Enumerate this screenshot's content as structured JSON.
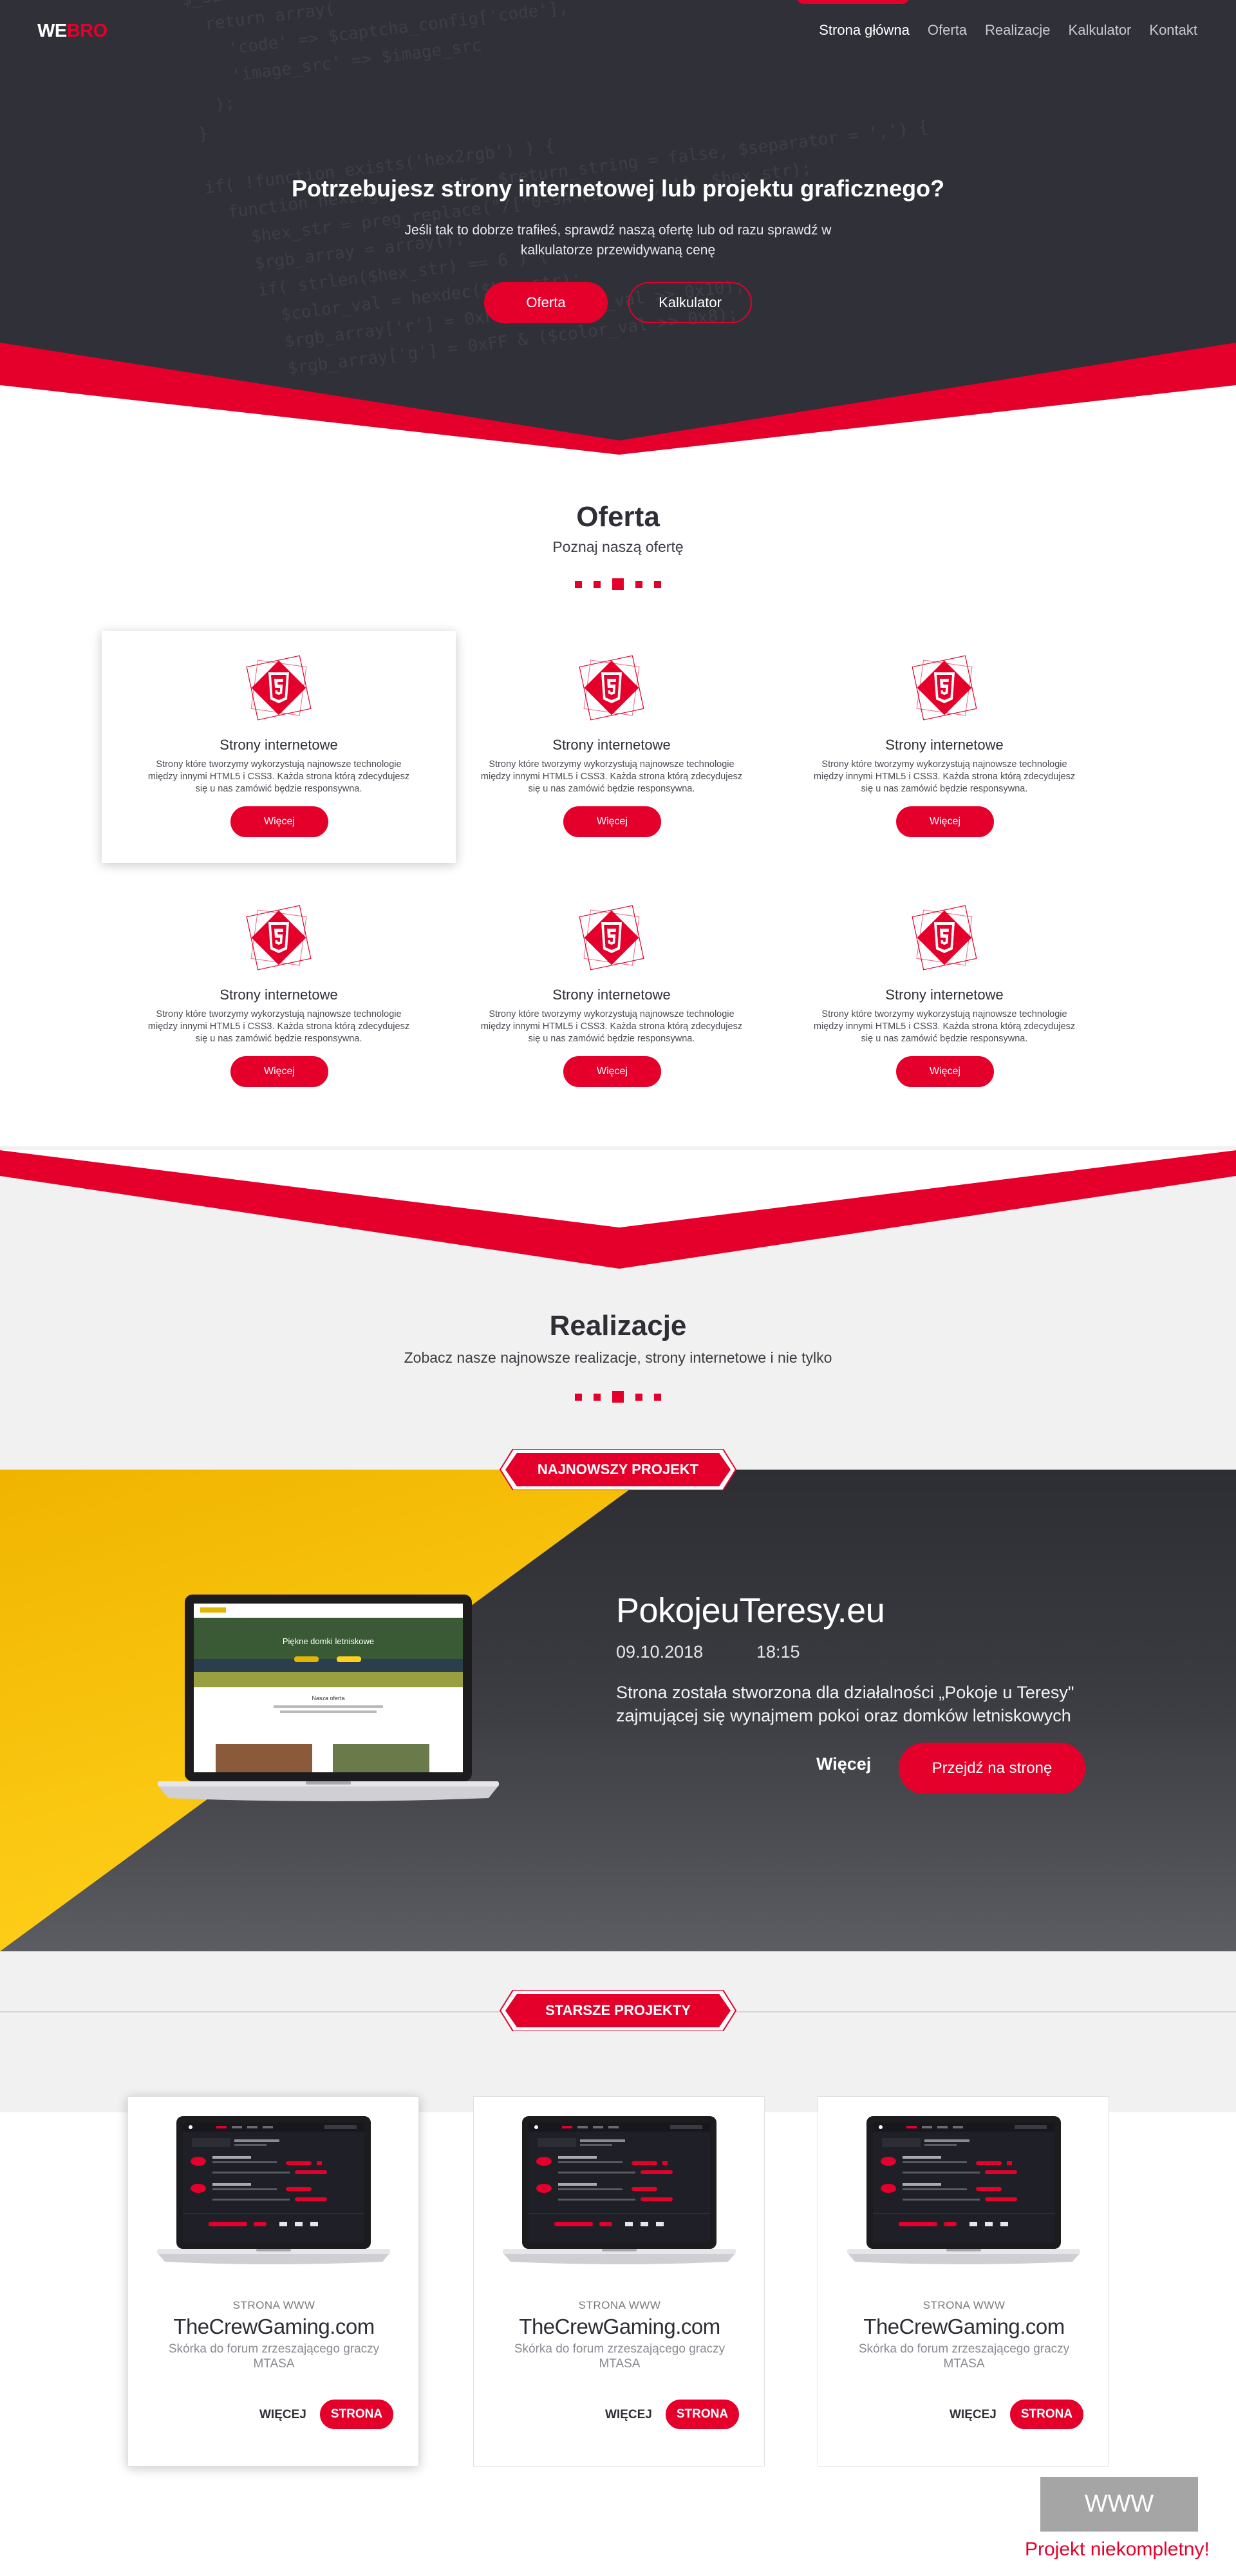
{
  "brand": {
    "logo_part1": "WE",
    "logo_part2": "BRO"
  },
  "nav": {
    "items": [
      {
        "label": "Strona główna",
        "active": true
      },
      {
        "label": "Oferta"
      },
      {
        "label": "Realizacje"
      },
      {
        "label": "Kalkulator"
      },
      {
        "label": "Kontakt"
      }
    ]
  },
  "hero": {
    "title": "Potrzebujesz strony internetowej lub projektu graficznego?",
    "subtitle": "Jeśli tak to dobrze trafiłeś, sprawdź naszą ofertę lub od razu sprawdź w kalkulatorze przewidywaną cenę",
    "btn_primary": "Oferta",
    "btn_secondary": "Kalkulator",
    "code_bg": "$_SESSION['_CAPTCHA']['config'] = serialize($captcha_config);\n  return array(\n    'code' => $captcha_config['code'],\n    'image_src' => $image_src\n  );\n}\n\nif( !function_exists('hex2rgb') ) {\n  function hex2rgb($hex_str, $return_string = false, $separator = ',') {\n    $hex_str = preg_replace(\"/[^0-9A-Fa-f]/\", '', $hex_str);\n    $rgb_array = array();\n    if( strlen($hex_str) == 6 ) {\n      $color_val = hexdec($hex_str);\n      $rgb_array['r'] = 0xFF & ($color_val >> 0x10);\n      $rgb_array['g'] = 0xFF & ($color_val >> 0x8);"
  },
  "oferta": {
    "title": "Oferta",
    "subtitle": "Poznaj naszą ofertę",
    "items": [
      {
        "title": "Strony internetowe",
        "desc": "Strony które tworzymy wykorzystują najnowsze technologie między innymi HTML5 i CSS3. Każda strona którą zdecydujesz się u nas zamówić będzie responsywna.",
        "button": "Więcej",
        "icon": "html5-icon"
      },
      {
        "title": "Strony internetowe",
        "desc": "Strony które tworzymy wykorzystują najnowsze technologie między innymi HTML5 i CSS3. Każda strona którą zdecydujesz się u nas zamówić będzie responsywna.",
        "button": "Więcej",
        "icon": "html5-icon"
      },
      {
        "title": "Strony internetowe",
        "desc": "Strony które tworzymy wykorzystują najnowsze technologie między innymi HTML5 i CSS3. Każda strona którą zdecydujesz się u nas zamówić będzie responsywna.",
        "button": "Więcej",
        "icon": "html5-icon"
      },
      {
        "title": "Strony internetowe",
        "desc": "Strony które tworzymy wykorzystują najnowsze technologie między innymi HTML5 i CSS3. Każda strona którą zdecydujesz się u nas zamówić będzie responsywna.",
        "button": "Więcej",
        "icon": "html5-icon"
      },
      {
        "title": "Strony internetowe",
        "desc": "Strony które tworzymy wykorzystują najnowsze technologie między innymi HTML5 i CSS3. Każda strona którą zdecydujesz się u nas zamówić będzie responsywna.",
        "button": "Więcej",
        "icon": "html5-icon"
      },
      {
        "title": "Strony internetowe",
        "desc": "Strony które tworzymy wykorzystują najnowsze technologie między innymi HTML5 i CSS3. Każda strona którą zdecydujesz się u nas zamówić będzie responsywna.",
        "button": "Więcej",
        "icon": "html5-icon"
      }
    ]
  },
  "realizacje": {
    "title": "Realizacje",
    "subtitle": "Zobacz nasze najnowsze realizacje, strony internetowe i nie tylko"
  },
  "featured": {
    "ribbon": "NAJNOWSZY PROJEKT",
    "title": "PokojeuTeresy.eu",
    "date": "09.10.2018",
    "time": "18:15",
    "desc": "Strona została stworzona dla działalności „Pokoje u Teresy\" zajmującej się wynajmem pokoi oraz domków letniskowych",
    "more": "Więcej",
    "go": "Przejdź na stronę",
    "screen_heading": "Piękne domki letniskowe",
    "screen_section": "Nasza oferta"
  },
  "older": {
    "ribbon": "STARSZE PROJEKTY",
    "cards": [
      {
        "category": "STRONA WWW",
        "title": "TheCrewGaming.com",
        "desc": "Skórka do forum zrzeszającego graczy MTASA",
        "more": "WIĘCEJ",
        "button": "STRONA"
      },
      {
        "category": "STRONA WWW",
        "title": "TheCrewGaming.com",
        "desc": "Skórka do forum zrzeszającego graczy MTASA",
        "more": "WIĘCEJ",
        "button": "STRONA"
      },
      {
        "category": "STRONA WWW",
        "title": "TheCrewGaming.com",
        "desc": "Skórka do forum zrzeszającego graczy MTASA",
        "more": "WIĘCEJ",
        "button": "STRONA"
      }
    ]
  },
  "badge": {
    "label": "WWW",
    "note": "Projekt niekompletny!"
  },
  "colors": {
    "accent": "#e4002b",
    "dark": "#2f3038",
    "yellow": "#f5c400",
    "light_gray": "#f1f1f1"
  }
}
